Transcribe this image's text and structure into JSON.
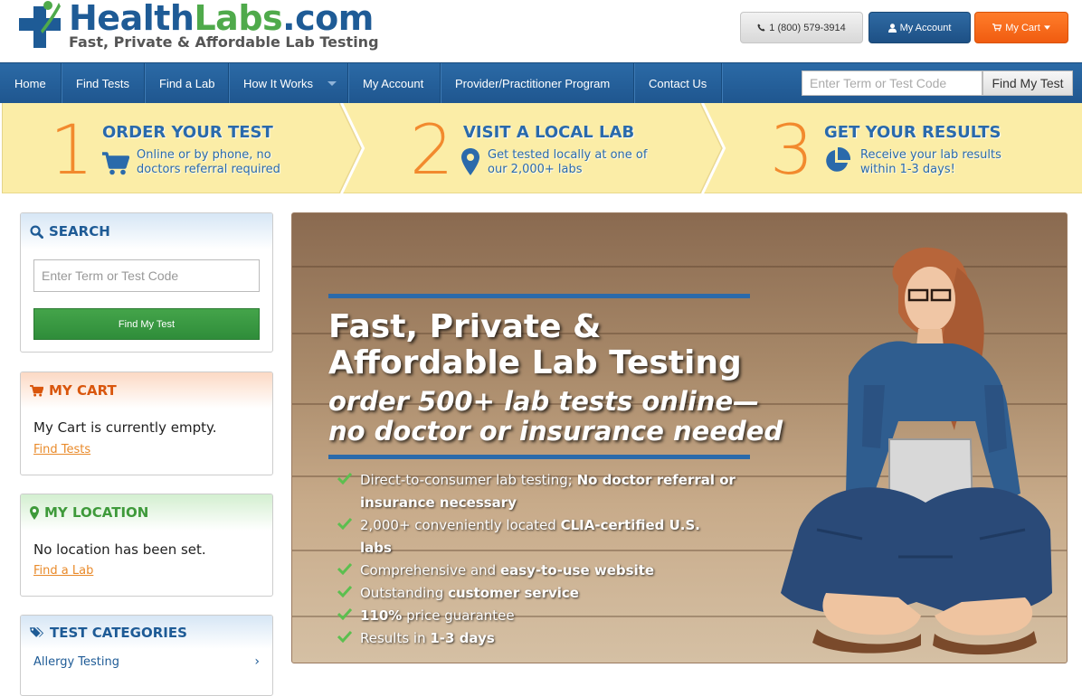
{
  "header": {
    "logo": {
      "health": "Health",
      "labs": "Labs",
      "com": ".com",
      "tagline": "Fast, Private & Affordable Lab Testing"
    },
    "phone_label": "1 (800) 579-3914",
    "account_label": "My Account",
    "cart_label": "My Cart"
  },
  "nav": {
    "items": [
      {
        "label": "Home"
      },
      {
        "label": "Find Tests"
      },
      {
        "label": "Find a Lab"
      },
      {
        "label": "How It Works"
      },
      {
        "label": "My Account"
      },
      {
        "label": "Provider/Practitioner Program"
      },
      {
        "label": "Contact Us"
      }
    ],
    "search_placeholder": "Enter Term or Test Code",
    "search_button": "Find My Test"
  },
  "steps": [
    {
      "number": "1",
      "title": "ORDER YOUR TEST",
      "line1": "Online or by phone, no",
      "line2": "doctors referral required",
      "icon": "cart-icon"
    },
    {
      "number": "2",
      "title": "VISIT A LOCAL LAB",
      "line1": "Get tested locally at one of",
      "line2": "our 2,000+ labs",
      "icon": "map-marker-icon"
    },
    {
      "number": "3",
      "title": "GET YOUR RESULTS",
      "line1": "Receive your lab results",
      "line2": "within 1-3 days!",
      "icon": "pie-chart-icon"
    }
  ],
  "sidebar": {
    "search": {
      "title": "SEARCH",
      "placeholder": "Enter Term or Test Code",
      "button": "Find My Test"
    },
    "cart": {
      "title": "MY CART",
      "text": "My Cart is currently empty.",
      "link": "Find Tests"
    },
    "location": {
      "title": "MY LOCATION",
      "text": "No location has been set.",
      "link": "Find a Lab"
    },
    "categories": {
      "title": "TEST CATEGORIES",
      "items": [
        {
          "label": "Allergy Testing"
        }
      ]
    }
  },
  "hero": {
    "title_line1": "Fast, Private &",
    "title_line2": "Affordable Lab Testing",
    "sub_line1": "order 500+ lab tests online—",
    "sub_line2": "no doctor or insurance needed",
    "bullets": [
      {
        "normal": "Direct-to-consumer lab testing; ",
        "bold": "No doctor referral or insurance necessary",
        "after": ""
      },
      {
        "normal": "2,000+ conveniently located ",
        "bold": "CLIA-certified U.S. labs",
        "after": ""
      },
      {
        "normal": "Comprehensive and ",
        "bold": "easy-to-use website",
        "after": ""
      },
      {
        "normal": "Outstanding ",
        "bold": "customer service",
        "after": ""
      },
      {
        "normal": "",
        "bold": "110%",
        "after": " price guarantee"
      },
      {
        "normal": "Results in ",
        "bold": "1-3 days",
        "after": ""
      }
    ]
  },
  "colors": {
    "brand_blue": "#1e5b96",
    "brand_green": "#4faa4b",
    "accent_orange": "#f28a2e",
    "steps_bg": "#fbeda7"
  }
}
